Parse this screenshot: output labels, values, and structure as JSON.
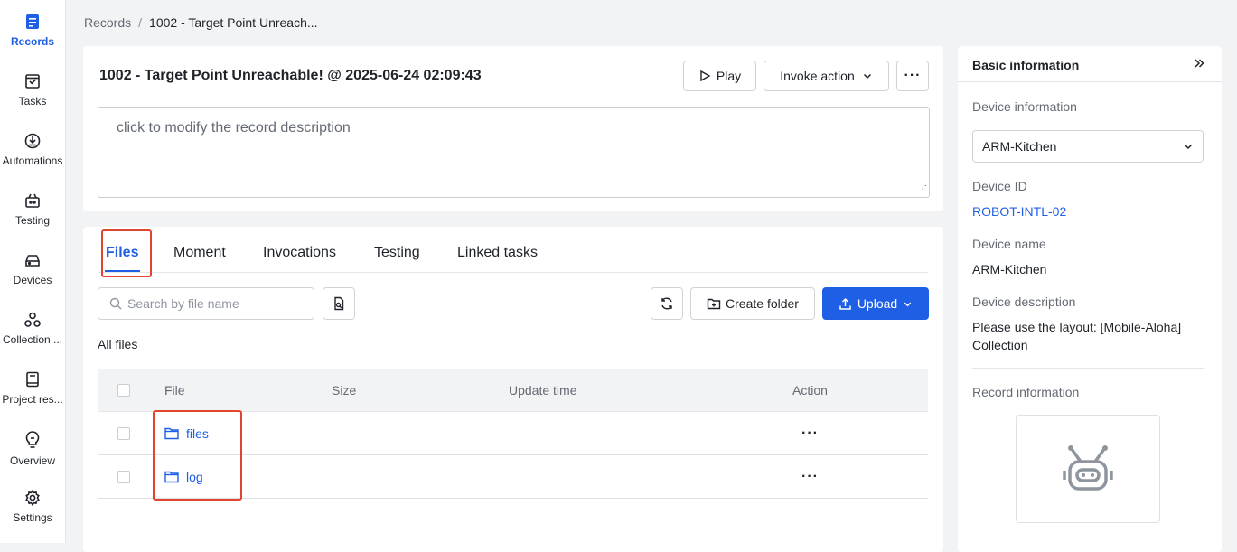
{
  "sidebar": {
    "items": [
      {
        "label": "Records",
        "icon": "records-icon",
        "active": true
      },
      {
        "label": "Tasks",
        "icon": "tasks-icon"
      },
      {
        "label": "Automations",
        "icon": "automations-icon"
      },
      {
        "label": "Testing",
        "icon": "testing-icon"
      },
      {
        "label": "Devices",
        "icon": "devices-icon"
      },
      {
        "label": "Collection ...",
        "icon": "collection-icon"
      },
      {
        "label": "Project res...",
        "icon": "project-resources-icon"
      },
      {
        "label": "Overview",
        "icon": "overview-icon"
      },
      {
        "label": "Settings",
        "icon": "settings-icon"
      }
    ]
  },
  "breadcrumb": {
    "parent": "Records",
    "separator": "/",
    "current": "1002 - Target Point Unreach..."
  },
  "record": {
    "title": "1002 - Target Point Unreachable! @ 2025-06-24 02:09:43",
    "play_label": "Play",
    "invoke_label": "Invoke action",
    "more_label": "···",
    "description_placeholder": "click to modify the record description"
  },
  "tabs": [
    {
      "label": "Files",
      "active": true
    },
    {
      "label": "Moment"
    },
    {
      "label": "Invocations"
    },
    {
      "label": "Testing"
    },
    {
      "label": "Linked tasks"
    }
  ],
  "files_toolbar": {
    "search_placeholder": "Search by file name",
    "create_folder_label": "Create folder",
    "upload_label": "Upload"
  },
  "breadcrumb_files": "All files",
  "table": {
    "columns": [
      "File",
      "Size",
      "Update time",
      "Action"
    ],
    "rows": [
      {
        "name": "files",
        "size": "",
        "updated": "",
        "action": "···"
      },
      {
        "name": "log",
        "size": "",
        "updated": "",
        "action": "···"
      }
    ]
  },
  "panel": {
    "title": "Basic information",
    "device_information_label": "Device information",
    "device_select_value": "ARM-Kitchen",
    "device_id_label": "Device ID",
    "device_id_value": "ROBOT-INTL-02",
    "device_name_label": "Device name",
    "device_name_value": "ARM-Kitchen",
    "device_description_label": "Device description",
    "device_description_value": "Please use the layout: [Mobile-Aloha] Collection",
    "record_information_label": "Record information"
  },
  "colors": {
    "accent": "#1f5fe6",
    "highlight": "#e0452f"
  }
}
